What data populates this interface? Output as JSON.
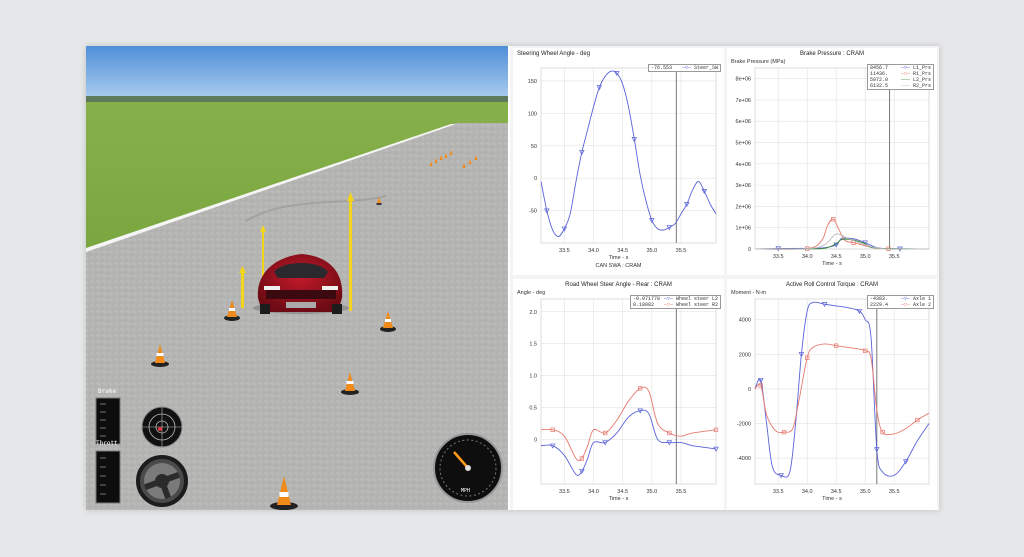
{
  "sim": {
    "hud_brake_label": "Brake",
    "hud_throttle_label": "Thrott",
    "speedometer_unit": "MPH"
  },
  "colors": {
    "blue": "#5a63d8",
    "red": "#e6786d",
    "green": "#3a8a3a",
    "gray": "#888888"
  },
  "charts": [
    {
      "id": "steer",
      "title": "Steering Wheel Angle - deg",
      "title_align": "left",
      "xlabel": "Time - s",
      "footer": "CAN SWA : CRAM",
      "ylabel": "",
      "chart_data": {
        "type": "line",
        "xlim": [
          33.1,
          36.1
        ],
        "ylim": [
          -100,
          170
        ],
        "xticks": [
          33.5,
          34.0,
          34.5,
          35.0,
          35.5
        ],
        "yticks": [
          -50,
          0,
          50,
          100,
          150
        ],
        "cursor_x": 35.42,
        "series": [
          {
            "name": "Steer_SW",
            "color": "#5a63d8",
            "marker": "triangle",
            "legend_value": "-76.553",
            "x": [
              33.1,
              33.2,
              33.3,
              33.4,
              33.5,
              33.6,
              33.7,
              33.8,
              33.9,
              34.0,
              34.1,
              34.2,
              34.3,
              34.4,
              34.5,
              34.6,
              34.7,
              34.8,
              34.9,
              35.0,
              35.1,
              35.2,
              35.3,
              35.4,
              35.5,
              35.6,
              35.7,
              35.8,
              35.9,
              36.0,
              36.1
            ],
            "values": [
              -5,
              -50,
              -80,
              -90,
              -78,
              -55,
              -5,
              40,
              75,
              110,
              140,
              157,
              165,
              162,
              145,
              110,
              60,
              5,
              -35,
              -65,
              -78,
              -80,
              -76,
              -70,
              -55,
              -40,
              -18,
              -5,
              -20,
              -40,
              -55
            ]
          }
        ]
      }
    },
    {
      "id": "brake",
      "title": "Brake Pressure : CRAM",
      "title_align": "center",
      "xlabel": "Time - s",
      "footer": "",
      "ylabel": "Brake Pressure (MPa)",
      "chart_data": {
        "type": "line",
        "xlim": [
          33.1,
          36.1
        ],
        "ylim": [
          0,
          8500000
        ],
        "xticks": [
          33.5,
          34.0,
          34.5,
          35.0,
          35.5
        ],
        "yticks": [
          0,
          1000000,
          2000000,
          3000000,
          4000000,
          5000000,
          6000000,
          7000000,
          8000000
        ],
        "ytick_labels": [
          "0",
          "1e+06",
          "2e+06",
          "3e+06",
          "4e+06",
          "5e+06",
          "6e+06",
          "7e+06",
          "8e+06"
        ],
        "cursor_x": 35.42,
        "series": [
          {
            "name": "L1_Prs",
            "color": "#5a63d8",
            "marker": "triangle",
            "legend_value": "8456.7",
            "x": [
              33.1,
              33.5,
              34.0,
              34.3,
              34.5,
              34.6,
              34.8,
              35.0,
              35.2,
              35.4,
              35.6,
              36.1
            ],
            "values": [
              0,
              20000,
              30000,
              60000,
              200000,
              500000,
              480000,
              300000,
              60000,
              20000,
              10000,
              0
            ]
          },
          {
            "name": "R1_Prs",
            "color": "#e6786d",
            "marker": "square",
            "legend_value": "11436.",
            "x": [
              33.1,
              34.0,
              34.25,
              34.35,
              34.45,
              34.55,
              34.65,
              34.8,
              35.0,
              35.2,
              35.4,
              36.1
            ],
            "values": [
              0,
              20000,
              400000,
              1100000,
              1400000,
              900000,
              400000,
              300000,
              150000,
              40000,
              10000,
              0
            ]
          },
          {
            "name": "L2_Prs",
            "color": "#3a8a3a",
            "marker": "none",
            "legend_value": "5972.0",
            "x": [
              33.1,
              34.0,
              34.3,
              34.5,
              34.6,
              34.8,
              35.0,
              35.2,
              36.1
            ],
            "values": [
              0,
              10000,
              30000,
              250000,
              450000,
              420000,
              250000,
              40000,
              0
            ]
          },
          {
            "name": "R2_Prs",
            "color": "#bbbbbb",
            "marker": "none",
            "legend_value": "6132.5",
            "x": [
              33.1,
              34.0,
              34.3,
              34.5,
              34.7,
              35.0,
              35.3,
              36.1
            ],
            "values": [
              0,
              15000,
              200000,
              700000,
              500000,
              200000,
              20000,
              0
            ]
          }
        ]
      }
    },
    {
      "id": "rwsa",
      "title": "Road Wheel Steer Angle - Rear : CRAM",
      "title_align": "center",
      "xlabel": "Time - s",
      "footer": "",
      "ylabel": "Angle - deg",
      "chart_data": {
        "type": "line",
        "xlim": [
          33.1,
          36.1
        ],
        "ylim": [
          -0.7,
          2.2
        ],
        "xticks": [
          33.5,
          34.0,
          34.5,
          35.0,
          35.5
        ],
        "yticks": [
          0,
          0.5,
          1.0,
          1.5,
          2.0
        ],
        "ytick_labels": [
          "0",
          "0.5",
          "1.0",
          "1.5",
          "2.0"
        ],
        "cursor_x": 35.42,
        "series": [
          {
            "name": "Wheel steer L2",
            "color": "#5a63d8",
            "marker": "triangle",
            "legend_value": "-0.071778",
            "x": [
              33.1,
              33.3,
              33.5,
              33.7,
              33.8,
              33.9,
              34.0,
              34.2,
              34.4,
              34.6,
              34.8,
              34.95,
              35.1,
              35.3,
              35.5,
              35.7,
              36.1
            ],
            "values": [
              -0.1,
              -0.1,
              -0.25,
              -0.55,
              -0.5,
              -0.3,
              -0.05,
              -0.05,
              0.1,
              0.35,
              0.45,
              0.4,
              0.0,
              -0.05,
              -0.05,
              -0.1,
              -0.15
            ]
          },
          {
            "name": "Wheel steer R2",
            "color": "#e6786d",
            "marker": "square",
            "legend_value": "0.18082",
            "x": [
              33.1,
              33.3,
              33.5,
              33.7,
              33.8,
              33.9,
              34.0,
              34.2,
              34.4,
              34.6,
              34.8,
              34.95,
              35.1,
              35.3,
              35.5,
              35.7,
              36.1
            ],
            "values": [
              0.15,
              0.15,
              0.05,
              -0.3,
              -0.3,
              -0.1,
              0.15,
              0.1,
              0.3,
              0.6,
              0.8,
              0.75,
              0.25,
              0.1,
              0.05,
              0.1,
              0.15
            ]
          }
        ]
      }
    },
    {
      "id": "arc",
      "title": "Active Roll Control Torque : CRAM",
      "title_align": "center",
      "xlabel": "Time - s",
      "footer": "",
      "ylabel": "Moment - N-m",
      "chart_data": {
        "type": "line",
        "xlim": [
          33.1,
          36.1
        ],
        "ylim": [
          -5500,
          5200
        ],
        "xticks": [
          33.5,
          34.0,
          34.5,
          35.0,
          35.5
        ],
        "yticks": [
          -4000,
          -2000,
          0,
          2000,
          4000
        ],
        "ytick_labels": [
          "-4000",
          "-2000",
          "0",
          "2000",
          "4000"
        ],
        "cursor_x": 35.2,
        "series": [
          {
            "name": "Axle 1",
            "color": "#5a63d8",
            "marker": "triangle",
            "legend_value": "-4383.",
            "x": [
              33.1,
              33.2,
              33.3,
              33.4,
              33.55,
              33.7,
              33.8,
              33.9,
              34.0,
              34.1,
              34.3,
              34.5,
              34.7,
              34.9,
              35.0,
              35.1,
              35.2,
              35.3,
              35.5,
              35.7,
              35.9,
              36.1
            ],
            "values": [
              0,
              500,
              -2000,
              -4500,
              -5000,
              -4800,
              -2000,
              2000,
              4500,
              5000,
              4900,
              4800,
              4700,
              4500,
              4000,
              3000,
              -3500,
              -4800,
              -5000,
              -4200,
              -3000,
              -2000
            ]
          },
          {
            "name": "Axle 2",
            "color": "#e6786d",
            "marker": "square",
            "legend_value": "2229.4",
            "x": [
              33.1,
              33.2,
              33.3,
              33.45,
              33.6,
              33.75,
              33.85,
              34.0,
              34.1,
              34.3,
              34.5,
              34.7,
              34.9,
              35.0,
              35.1,
              35.2,
              35.3,
              35.5,
              35.7,
              35.9,
              36.1
            ],
            "values": [
              0,
              200,
              -1500,
              -2400,
              -2500,
              -2300,
              -800,
              1800,
              2400,
              2600,
              2500,
              2400,
              2300,
              2200,
              1800,
              -1200,
              -2500,
              -2600,
              -2300,
              -1800,
              -1400
            ]
          }
        ]
      }
    }
  ]
}
